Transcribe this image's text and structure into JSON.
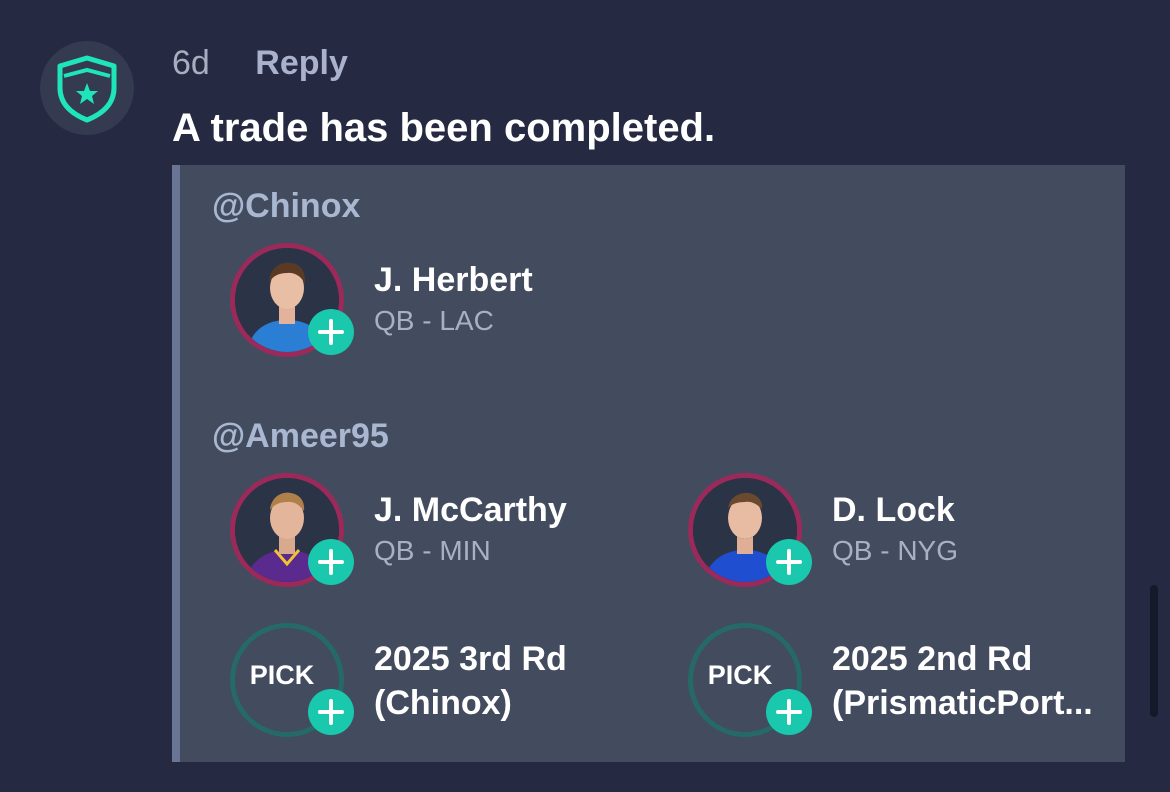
{
  "comment": {
    "time": "6d",
    "reply_label": "Reply",
    "message": "A trade has been completed."
  },
  "trade": {
    "sections": [
      {
        "user": "@Chinox",
        "assets": [
          {
            "type": "player",
            "name": "J. Herbert",
            "detail": "QB - LAC",
            "jersey_color": "#2a7fd4"
          }
        ]
      },
      {
        "user": "@Ameer95",
        "assets": [
          {
            "type": "player",
            "name": "J. McCarthy",
            "detail": "QB - MIN",
            "jersey_color": "#5a2a8f"
          },
          {
            "type": "player",
            "name": "D. Lock",
            "detail": "QB - NYG",
            "jersey_color": "#1f4fd0"
          },
          {
            "type": "pick",
            "badge": "PICK",
            "line1": "2025 3rd Rd",
            "line2": "(Chinox)"
          },
          {
            "type": "pick",
            "badge": "PICK",
            "line1": "2025 2nd Rd",
            "line2": "(PrismaticPort..."
          }
        ]
      }
    ]
  },
  "colors": {
    "background": "#252a42",
    "card": "#434b5f",
    "accent_teal": "#19c8ad",
    "player_ring": "#9b2a5a",
    "pick_ring": "#256a66"
  },
  "icons": {
    "bot_avatar": "shield-star-icon",
    "add": "plus-icon"
  }
}
